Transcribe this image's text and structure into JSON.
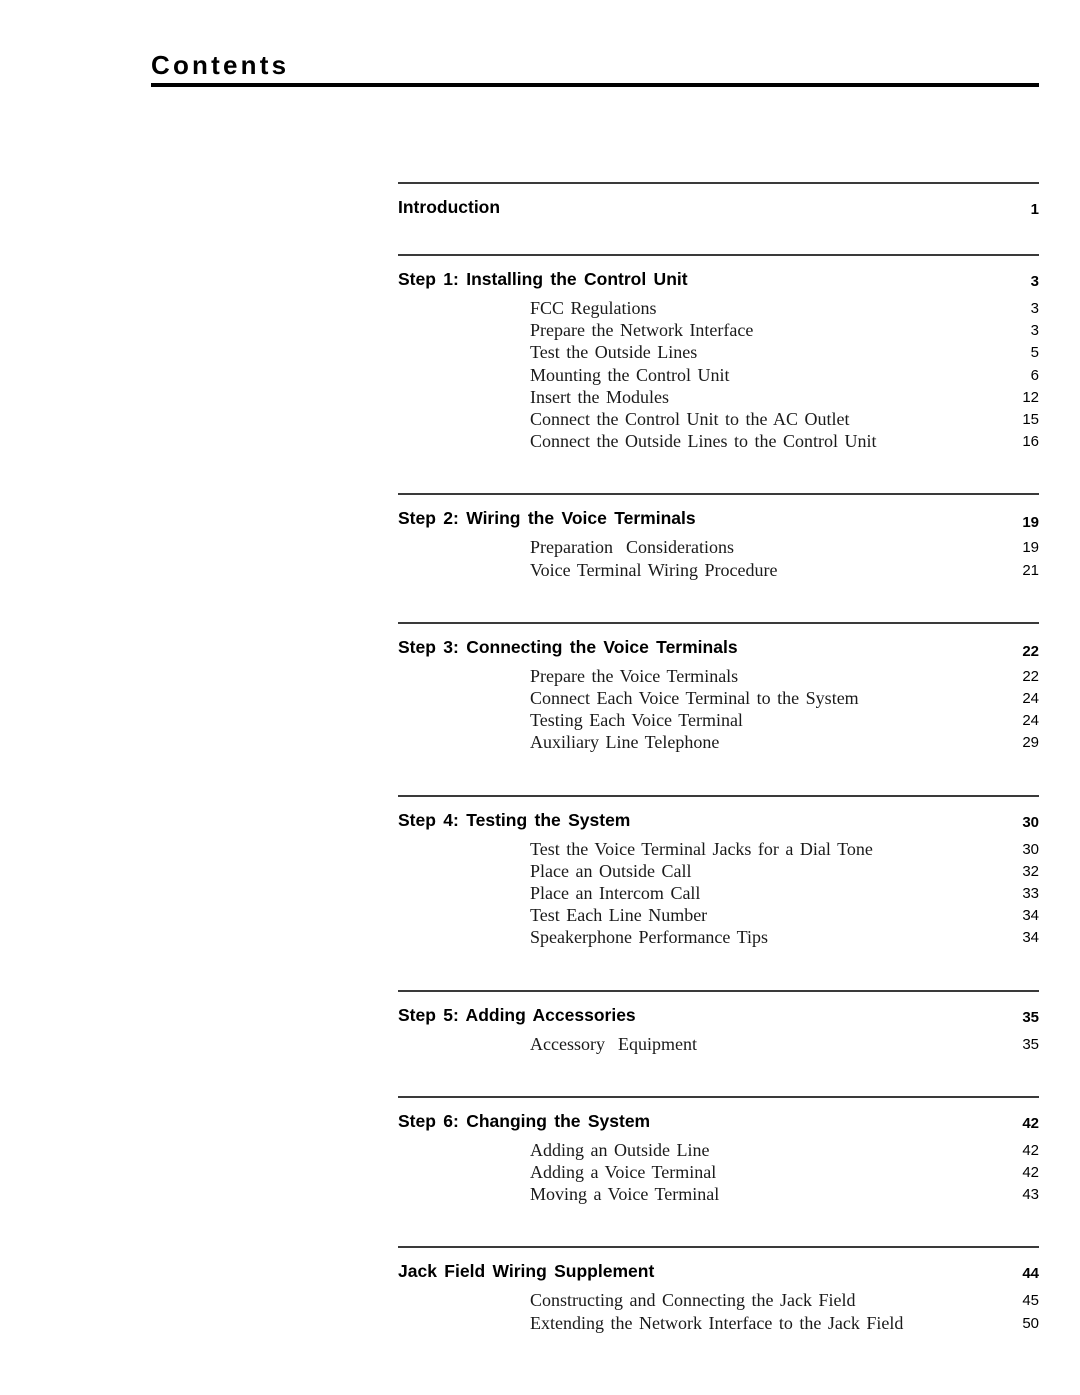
{
  "document": {
    "title": "Contents"
  },
  "toc": {
    "sections": [
      {
        "heading": "Introduction",
        "page": "1",
        "entries": []
      },
      {
        "heading": "Step 1: Installing the Control Unit",
        "page": "3",
        "entries": [
          {
            "label": "FCC Regulations",
            "page": "3"
          },
          {
            "label": "Prepare the Network Interface",
            "page": "3"
          },
          {
            "label": "Test the Outside Lines",
            "page": "5"
          },
          {
            "label": "Mounting the Control Unit",
            "page": "6"
          },
          {
            "label": "Insert the Modules",
            "page": "12"
          },
          {
            "label": "Connect the Control Unit to the AC Outlet",
            "page": "15"
          },
          {
            "label": "Connect the Outside Lines to the Control Unit",
            "page": "16"
          }
        ]
      },
      {
        "heading": "Step 2: Wiring the Voice Terminals",
        "page": "19",
        "entries": [
          {
            "label": "Preparation  Considerations",
            "page": "19"
          },
          {
            "label": "Voice Terminal Wiring Procedure",
            "page": "21"
          }
        ]
      },
      {
        "heading": "Step 3: Connecting the Voice Terminals",
        "page": "22",
        "entries": [
          {
            "label": "Prepare the Voice Terminals",
            "page": "22"
          },
          {
            "label": "Connect Each Voice Terminal to the System",
            "page": "24"
          },
          {
            "label": "Testing Each Voice Terminal",
            "page": "24"
          },
          {
            "label": "Auxiliary Line Telephone",
            "page": "29"
          }
        ]
      },
      {
        "heading": "Step 4: Testing the System",
        "page": "30",
        "entries": [
          {
            "label": "Test the Voice Terminal Jacks for a Dial Tone",
            "page": "30"
          },
          {
            "label": "Place an Outside Call",
            "page": "32"
          },
          {
            "label": "Place an Intercom Call",
            "page": "33"
          },
          {
            "label": "Test Each Line Number",
            "page": "34"
          },
          {
            "label": "Speakerphone Performance Tips",
            "page": "34"
          }
        ]
      },
      {
        "heading": "Step 5: Adding Accessories",
        "page": "35",
        "entries": [
          {
            "label": "Accessory  Equipment",
            "page": "35"
          }
        ]
      },
      {
        "heading": "Step 6: Changing the System",
        "page": "42",
        "entries": [
          {
            "label": "Adding an Outside Line",
            "page": "42"
          },
          {
            "label": "Adding a Voice Terminal",
            "page": "42"
          },
          {
            "label": "Moving a Voice Terminal",
            "page": "43"
          }
        ]
      },
      {
        "heading": "Jack Field Wiring Supplement",
        "page": "44",
        "entries": [
          {
            "label": "Constructing and Connecting the Jack Field",
            "page": "45"
          },
          {
            "label": "Extending the Network Interface to the Jack Field",
            "page": "50"
          }
        ]
      }
    ]
  }
}
